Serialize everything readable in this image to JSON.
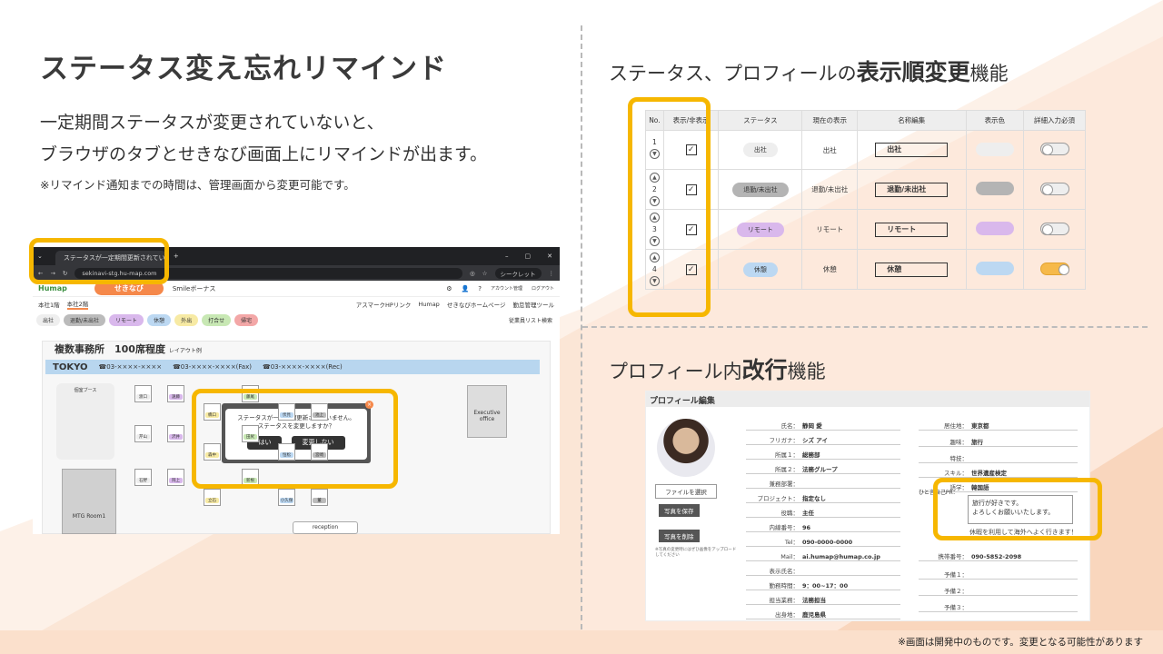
{
  "main_title": "ステータス変え忘れリマインド",
  "desc_line1": "一定期間ステータスが変更されていないと、",
  "desc_line2": "ブラウザのタブとせきなび画面上にリマインドが出ます。",
  "note": "※リマインド通知までの時間は、管理画面から変更可能です。",
  "footer_note": "※画面は開発中のものです。変更となる可能性があります",
  "section2_prefix": "ステータス、プロフィールの",
  "section2_bold": "表示順変更",
  "section2_suffix": "機能",
  "section3_prefix": "プロフィール内",
  "section3_bold": "改行",
  "section3_suffix": "機能",
  "browser": {
    "tab_title": "ステータスが一定期間更新されていません",
    "url": "sekinavi-stg.hu-map.com",
    "incognito": "シークレット",
    "logo": "Humap",
    "app_pill": "せきなび",
    "app_tab2": "Smileボーナス",
    "account": "アカウント管理",
    "logout": "ログアウト",
    "floor_tabs": [
      "本社1階",
      "本社2階"
    ],
    "links": [
      "アスマークHPリンク",
      "Humap",
      "せきなびホームページ",
      "勤怠管理ツール"
    ],
    "statuses": [
      "出社",
      "退勤/未出社",
      "リモート",
      "休憩",
      "外出",
      "打合せ",
      "帰宅"
    ],
    "employee_search": "従業員リスト検索",
    "office_title": "複数事務所　100席程度",
    "layout_link": "レイアウト例",
    "tokyo": "TOKYO",
    "tel": "☎03-××××-××××",
    "fax": "☎03-××××-××××(Fax)",
    "rec": "☎03-××××-××××(Rec)",
    "booth": "個室ブース",
    "exec": "Executive office",
    "mtg": "MTG Room1",
    "reception": "reception",
    "modal_line1": "ステータスが一定期間更新されていません。",
    "modal_line2": "ステータスを変更しますか？",
    "modal_yes": "はい",
    "modal_no": "変更しない",
    "seats": [
      "渡口",
      "藤尾",
      "遠藤",
      "伏見",
      "橋口",
      "池上",
      "芹山",
      "田尻",
      "沢井",
      "恒松",
      "森中",
      "宮崎",
      "石野",
      "新根",
      "岡上",
      "小久保",
      "立石",
      "董"
    ]
  },
  "status_table": {
    "headers": [
      "No.",
      "表示/非表示",
      "ステータス",
      "現在の表示",
      "名称編集",
      "表示色",
      "詳細入力必須"
    ],
    "rows": [
      {
        "no": "1",
        "status": "出社",
        "current": "出社",
        "name": "出社",
        "color": "#eeeeee",
        "badge": "#eeeeee",
        "required": false
      },
      {
        "no": "2",
        "status": "退勤/未出社",
        "current": "退勤/未出社",
        "name": "退勤/未出社",
        "color": "#b4b4b4",
        "badge": "#b4b4b4",
        "required": false
      },
      {
        "no": "3",
        "status": "リモート",
        "current": "リモート",
        "name": "リモート",
        "color": "#d9b8ec",
        "badge": "#d9b8ec",
        "required": false
      },
      {
        "no": "4",
        "status": "休憩",
        "current": "休憩",
        "name": "休憩",
        "color": "#bcd8f2",
        "badge": "#bcd8f2",
        "required": true
      }
    ]
  },
  "profile": {
    "title": "プロフィール編集",
    "file_btn": "ファイルを選択",
    "save_photo": "写真を保存",
    "delete_photo": "写真を削除",
    "photo_note": "※写真の変更時にはぜひ画像をアップロードしてください",
    "left_fields": [
      {
        "label": "氏名：",
        "value": "静岡 愛"
      },
      {
        "label": "フリガナ：",
        "value": "シズ アイ"
      },
      {
        "label": "所属１：",
        "value": "総務部"
      },
      {
        "label": "所属２：",
        "value": "法務グループ"
      },
      {
        "label": "兼務部署：",
        "value": ""
      },
      {
        "label": "プロジェクト：",
        "value": "指定なし"
      },
      {
        "label": "役職：",
        "value": "主任"
      },
      {
        "label": "内線番号：",
        "value": "96"
      },
      {
        "label": "Tel：",
        "value": "090-0000-0000"
      },
      {
        "label": "Mail：",
        "value": "ai.humap@humap.co.jp"
      },
      {
        "label": "表示氏名：",
        "value": ""
      },
      {
        "label": "勤務時間：",
        "value": "9：00~17：00"
      },
      {
        "label": "担当業務：",
        "value": "法務担当"
      },
      {
        "label": "出身地：",
        "value": "鹿児島県"
      }
    ],
    "right_fields": [
      {
        "label": "居住地：",
        "value": "東京都"
      },
      {
        "label": "趣味：",
        "value": "旅行"
      },
      {
        "label": "特技：",
        "value": ""
      },
      {
        "label": "スキル：",
        "value": "世界遺産検定"
      },
      {
        "label": "語学：",
        "value": "韓国語"
      },
      {
        "label": "携帯番号：",
        "value": "090-5852-2098"
      },
      {
        "label": "予備１：",
        "value": ""
      },
      {
        "label": "予備２：",
        "value": ""
      },
      {
        "label": "予備３：",
        "value": ""
      }
    ],
    "intro_label": "ひと言自己PR：",
    "intro_text1": "旅行が好きです。",
    "intro_text2": "よろしくお願いいたします。",
    "intro_overflow": "休暇を利用して海外へよく行きます！"
  },
  "colors": {
    "highlight": "#f6b700",
    "accent": "#f5884a",
    "bg_peach": "#fbe0cc"
  }
}
